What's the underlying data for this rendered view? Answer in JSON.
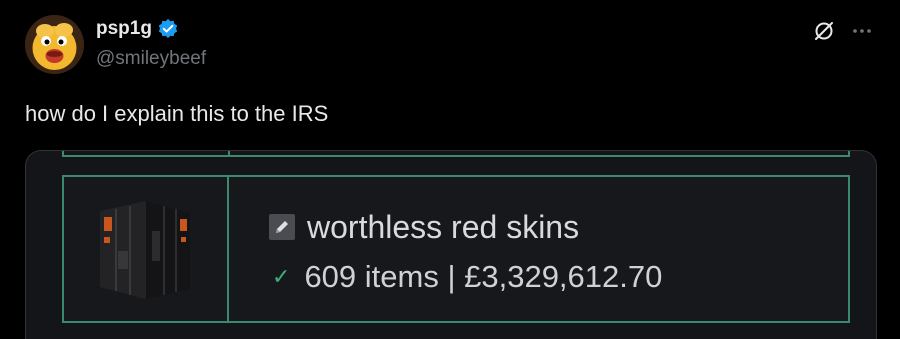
{
  "author": {
    "display_name": "psp1g",
    "handle": "@smileybeef",
    "verified": true
  },
  "tweet": {
    "text": "how do I explain this to the IRS"
  },
  "media": {
    "item_name": "worthless red skins",
    "count_label": "609 items | £3,329,612.70"
  },
  "icons": {
    "verified": "verified-badge-icon",
    "grok": "grok-icon",
    "more": "more-icon",
    "edit": "pencil-icon",
    "check": "check-icon"
  },
  "colors": {
    "background": "#000000",
    "text": "#e7e9ea",
    "muted": "#71767b",
    "verified": "#1d9bf0",
    "border_green": "#3b8a6e",
    "check_green": "#3fae7a"
  }
}
